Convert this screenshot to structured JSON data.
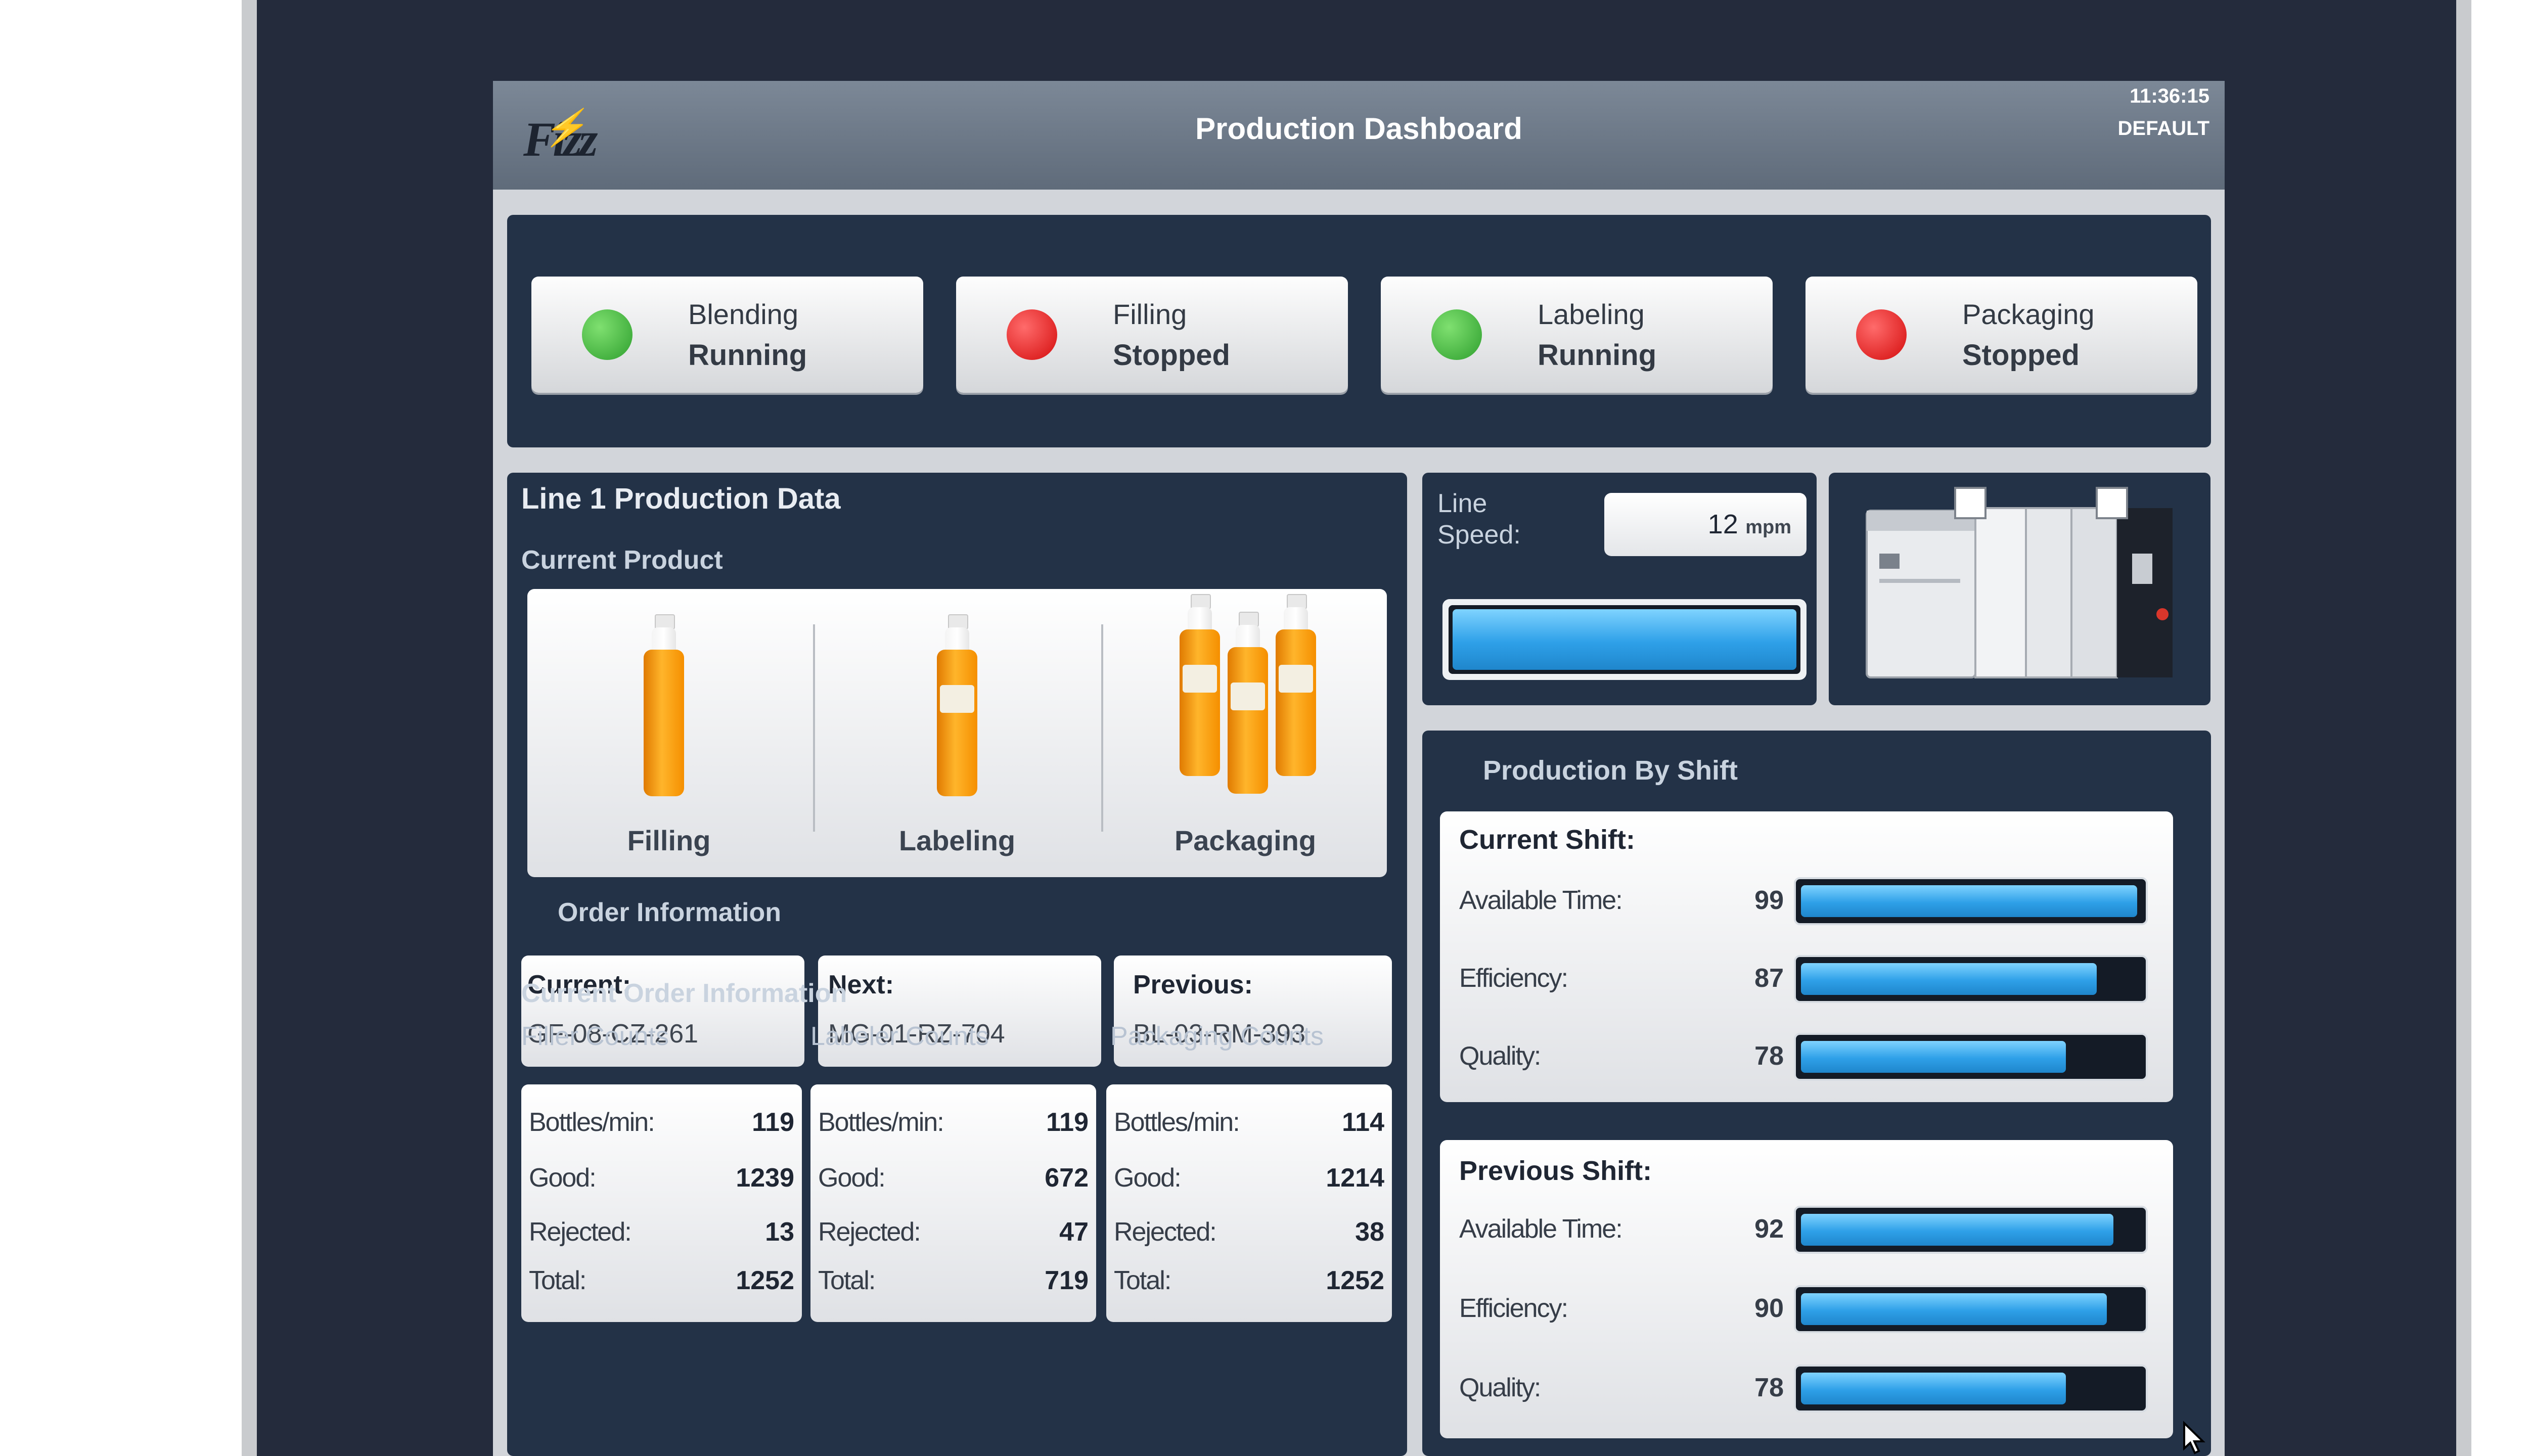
{
  "header": {
    "logo_text": "Fizz",
    "title": "Production Dashboard",
    "time": "11:36:15",
    "profile": "DEFAULT"
  },
  "stations": [
    {
      "name": "Blending",
      "state": "Running",
      "color": "#3aa83a"
    },
    {
      "name": "Filling",
      "state": "Stopped",
      "color": "#e01010"
    },
    {
      "name": "Labeling",
      "state": "Running",
      "color": "#3aa83a"
    },
    {
      "name": "Packaging",
      "state": "Stopped",
      "color": "#e01010"
    }
  ],
  "line1": {
    "title": "Line 1 Production Data",
    "current_product_label": "Current Product",
    "product_steps": [
      "Filling",
      "Labeling",
      "Packaging"
    ],
    "order_info_label": "Order Information",
    "orders": [
      {
        "key": "Current:",
        "value": "GF-08-CZ-261"
      },
      {
        "key": "Next:",
        "value": "MG-01-RZ-704"
      },
      {
        "key": "Previous:",
        "value": "BL-03-RM-393"
      }
    ],
    "current_order_label": "Current Order Information",
    "counts": [
      {
        "heading": "Filler Counts",
        "rows": [
          {
            "k": "Bottles/min:",
            "v": "119"
          },
          {
            "k": "Good:",
            "v": "1239"
          },
          {
            "k": "Rejected:",
            "v": "13"
          },
          {
            "k": "Total:",
            "v": "1252"
          }
        ]
      },
      {
        "heading": "Labeler Counts",
        "rows": [
          {
            "k": "Bottles/min:",
            "v": "119"
          },
          {
            "k": "Good:",
            "v": "672"
          },
          {
            "k": "Rejected:",
            "v": "47"
          },
          {
            "k": "Total:",
            "v": "719"
          }
        ]
      },
      {
        "heading": "Packaging Counts",
        "rows": [
          {
            "k": "Bottles/min:",
            "v": "114"
          },
          {
            "k": "Good:",
            "v": "1214"
          },
          {
            "k": "Rejected:",
            "v": "38"
          },
          {
            "k": "Total:",
            "v": "1252"
          }
        ]
      }
    ]
  },
  "line_speed": {
    "label": "Line\nSpeed:",
    "value": "12",
    "unit": "mpm",
    "bar_fraction": 1.0
  },
  "shift": {
    "title": "Production By Shift",
    "current": {
      "heading": "Current Shift:",
      "rows": [
        {
          "label": "Available Time:",
          "value": "99",
          "pct": 99
        },
        {
          "label": "Efficiency:",
          "value": "87",
          "pct": 87
        },
        {
          "label": "Quality:",
          "value": "78",
          "pct": 78
        }
      ]
    },
    "previous": {
      "heading": "Previous Shift:",
      "rows": [
        {
          "label": "Available Time:",
          "value": "92",
          "pct": 92
        },
        {
          "label": "Efficiency:",
          "value": "90",
          "pct": 90
        },
        {
          "label": "Quality:",
          "value": "78",
          "pct": 78
        }
      ]
    }
  }
}
